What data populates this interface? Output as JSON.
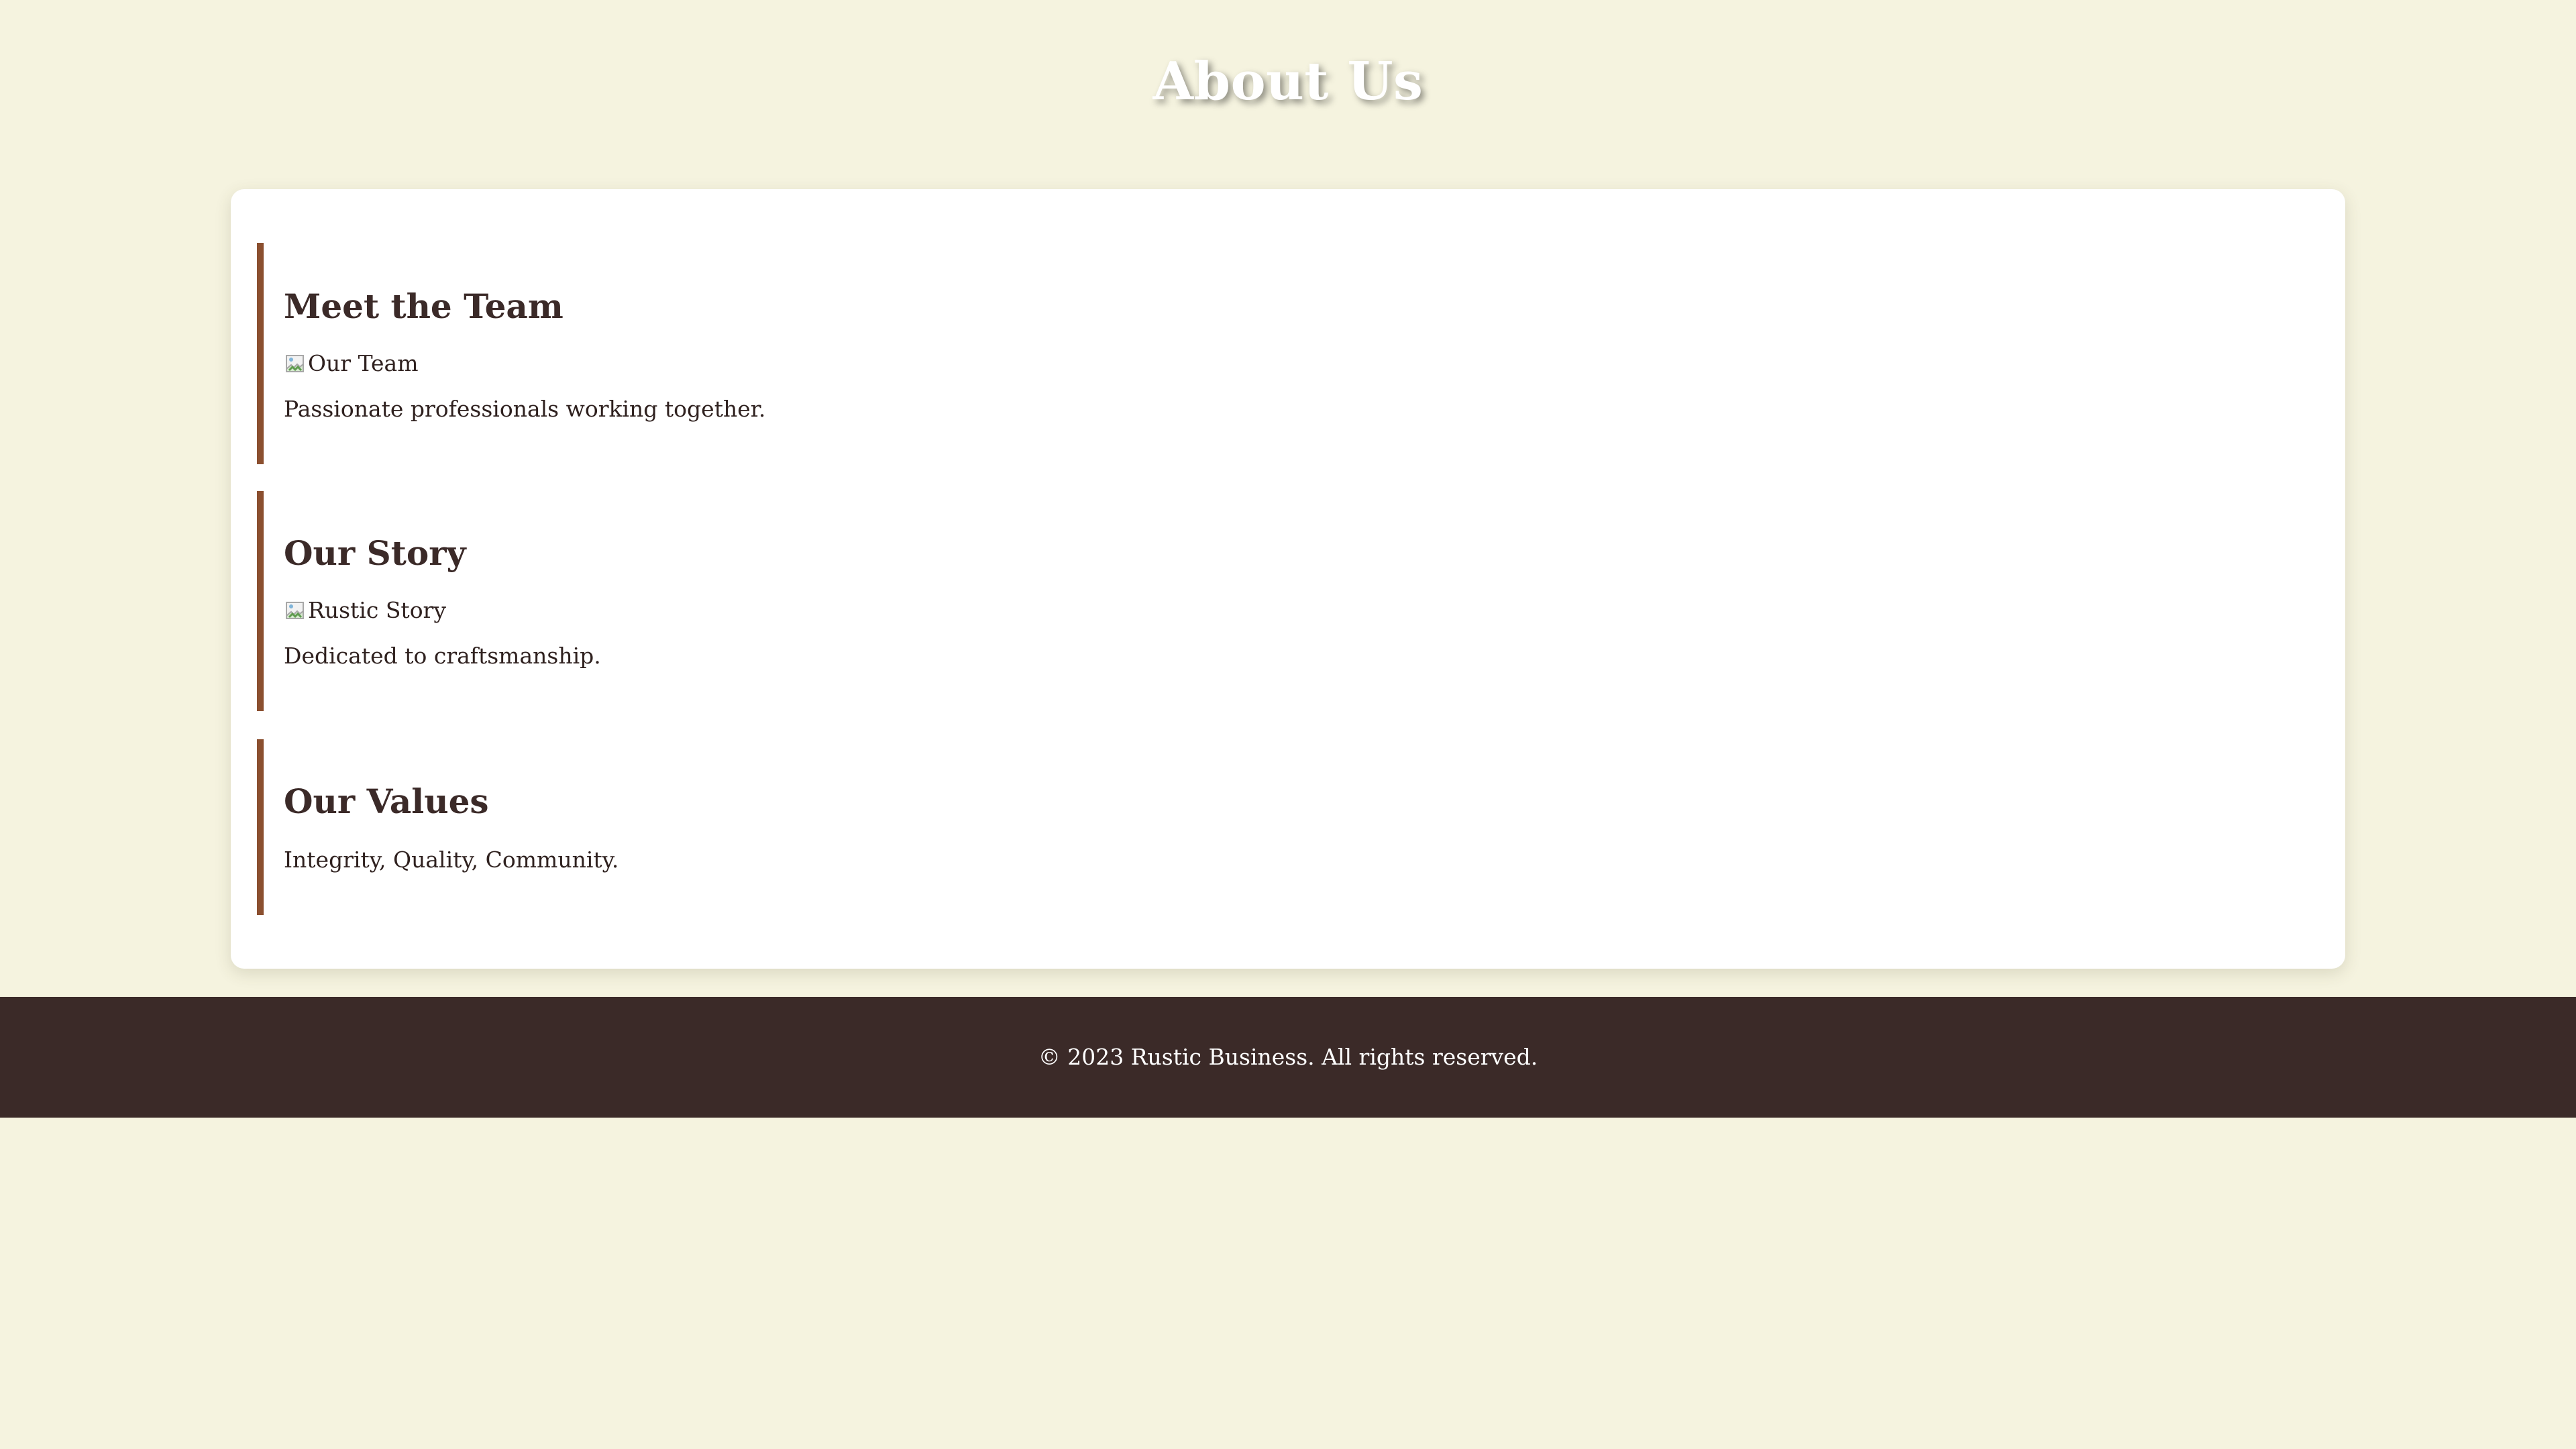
{
  "header": {
    "title": "About Us"
  },
  "sections": [
    {
      "heading": "Meet the Team",
      "image_alt": "Our Team",
      "text": "Passionate professionals working together."
    },
    {
      "heading": "Our Story",
      "image_alt": "Rustic Story",
      "text": "Dedicated to craftsmanship."
    },
    {
      "heading": "Our Values",
      "text": "Integrity, Quality, Community."
    }
  ],
  "footer": {
    "text": "© 2023 Rustic Business. All rights reserved."
  },
  "colors": {
    "background": "#f5f3df",
    "card": "#ffffff",
    "accent_border": "#8b4f2f",
    "heading_text": "#3b2a28",
    "footer_background": "#3b2a28",
    "title_text": "#ffffff"
  },
  "icons": {
    "broken_image": "broken-image-icon"
  }
}
